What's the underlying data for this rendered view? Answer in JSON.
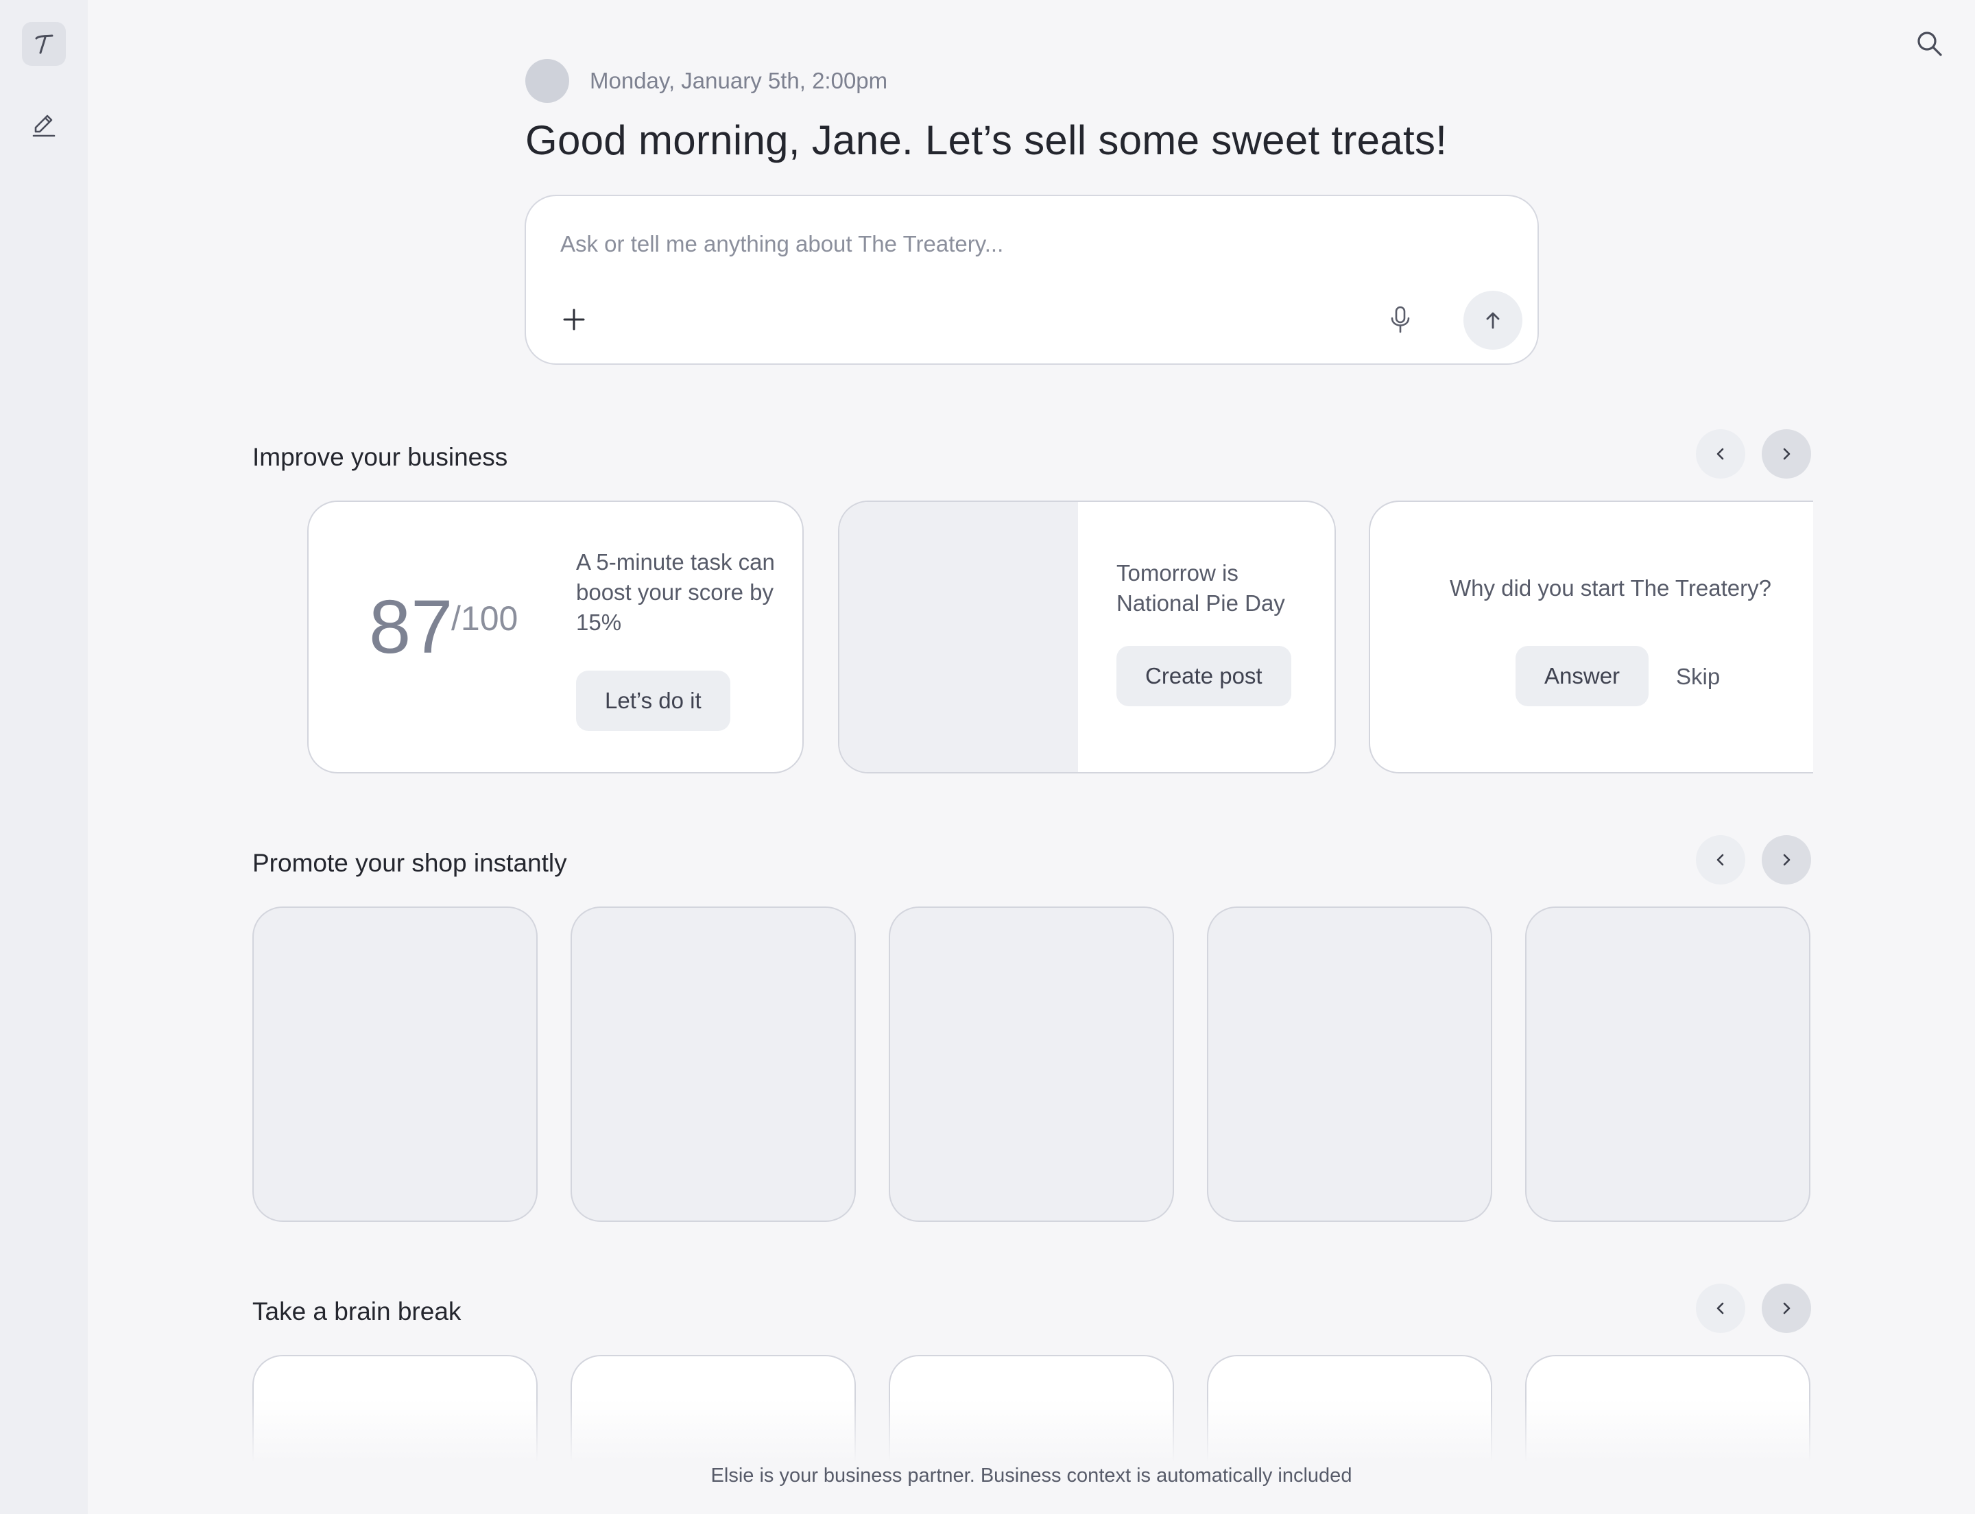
{
  "sidebar": {
    "items": [
      {
        "icon": "brand-t-icon",
        "active": true
      },
      {
        "icon": "compose-pen-icon",
        "active": false
      }
    ]
  },
  "header": {
    "search_icon": "search-icon",
    "date": "Monday, January 5th, 2:00pm",
    "greeting": "Good morning, Jane. Let’s sell some sweet treats!"
  },
  "composer": {
    "placeholder": "Ask or tell me anything about The Treatery...",
    "value": "",
    "attach_icon": "plus-icon",
    "mic_icon": "microphone-icon",
    "send_icon": "arrow-up-icon"
  },
  "sections": {
    "improve": {
      "title": "Improve your business",
      "cards": {
        "score": {
          "value": "87",
          "denominator": "/100",
          "text": "A 5-minute task can boost your score by 15%",
          "button": "Let’s do it"
        },
        "pie_day": {
          "text": "Tomorrow is National Pie Day",
          "button": "Create post"
        },
        "question": {
          "text": "Why did you start The Treatery?",
          "answer_button": "Answer",
          "skip_button": "Skip"
        }
      }
    },
    "promote": {
      "title": "Promote your shop instantly",
      "tile_count": 5
    },
    "brain_break": {
      "title": "Take a brain break",
      "tile_count": 5
    }
  },
  "footer": {
    "text": "Elsie is your business partner. Business context is automatically included"
  },
  "colors": {
    "background": "#f6f6f8",
    "sidebar": "#eeeff3",
    "card_border": "#d3d5dd",
    "pill": "#eceef2",
    "text_primary": "#24262e",
    "text_muted": "#7d8190"
  }
}
